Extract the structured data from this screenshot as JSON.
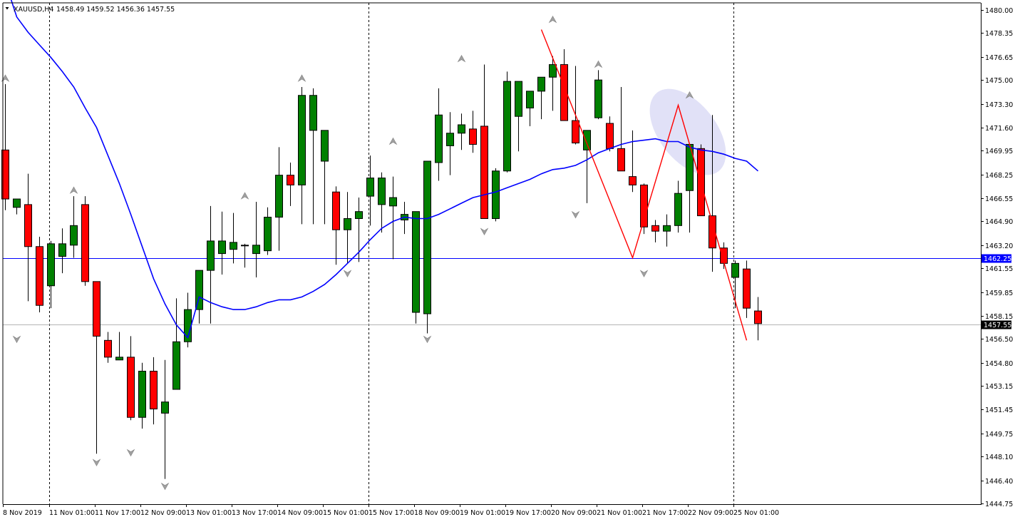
{
  "header": {
    "symbol": "XAUUSD,H4",
    "ohlc": "1458.49 1459.52 1456.36 1457.55"
  },
  "price_labels": {
    "horizontal_line": "1462.25",
    "current_price": "1457.55"
  },
  "colors": {
    "bull": "#008000",
    "bear": "#ff0000",
    "ma": "#0000ff",
    "zigzag": "#ff0000",
    "hline": "#0000ff",
    "highlight": "#c8c8f0",
    "grid_sep": "#000000"
  },
  "chart_data": {
    "type": "candlestick",
    "symbol": "XAUUSD",
    "timeframe": "H4",
    "ylim": [
      1444.75,
      1480.0
    ],
    "y_ticks": [
      "1480.00",
      "1478.35",
      "1476.65",
      "1475.00",
      "1473.30",
      "1471.60",
      "1469.95",
      "1468.25",
      "1466.55",
      "1464.90",
      "1463.20",
      "1461.55",
      "1459.85",
      "1458.15",
      "1456.50",
      "1454.80",
      "1453.15",
      "1451.45",
      "1449.75",
      "1448.10",
      "1446.40",
      "1444.75"
    ],
    "x_ticks": [
      "8 Nov 2019",
      "11 Nov 01:00",
      "11 Nov 17:00",
      "12 Nov 09:00",
      "13 Nov 01:00",
      "13 Nov 17:00",
      "14 Nov 09:00",
      "15 Nov 01:00",
      "15 Nov 17:00",
      "18 Nov 09:00",
      "19 Nov 01:00",
      "19 Nov 17:00",
      "20 Nov 09:00",
      "21 Nov 01:00",
      "21 Nov 17:00",
      "22 Nov 09:00",
      "25 Nov 01:00"
    ],
    "candles": [
      [
        1470.0,
        1474.7,
        1465.7,
        1466.5
      ],
      [
        1465.9,
        1466.5,
        1465.4,
        1466.5
      ],
      [
        1466.1,
        1468.3,
        1459.2,
        1463.1
      ],
      [
        1463.1,
        1463.8,
        1458.4,
        1458.9
      ],
      [
        1460.3,
        1463.5,
        1458.7,
        1463.3
      ],
      [
        1462.4,
        1464.4,
        1461.2,
        1463.3
      ],
      [
        1463.2,
        1466.7,
        1462.3,
        1464.6
      ],
      [
        1466.1,
        1466.7,
        1460.3,
        1460.6
      ],
      [
        1460.6,
        1460.6,
        1448.3,
        1456.7
      ],
      [
        1456.4,
        1457.0,
        1454.8,
        1455.2
      ],
      [
        1455.0,
        1457.0,
        1455.0,
        1455.2
      ],
      [
        1455.2,
        1456.7,
        1450.7,
        1450.9
      ],
      [
        1450.9,
        1454.8,
        1450.1,
        1454.2
      ],
      [
        1454.2,
        1455.2,
        1450.4,
        1451.5
      ],
      [
        1451.2,
        1455.0,
        1446.5,
        1452.0
      ],
      [
        1452.9,
        1459.4,
        1452.9,
        1456.3
      ],
      [
        1456.3,
        1459.8,
        1455.9,
        1458.6
      ],
      [
        1458.6,
        1461.4,
        1457.6,
        1461.4
      ],
      [
        1461.4,
        1466.0,
        1457.6,
        1463.5
      ],
      [
        1462.6,
        1465.6,
        1461.1,
        1463.5
      ],
      [
        1462.9,
        1465.5,
        1461.9,
        1463.4
      ],
      [
        1463.2,
        1463.3,
        1461.6,
        1463.2
      ],
      [
        1462.6,
        1466.3,
        1460.9,
        1463.2
      ],
      [
        1462.8,
        1465.9,
        1462.5,
        1465.2
      ],
      [
        1465.2,
        1470.2,
        1462.8,
        1468.2
      ],
      [
        1468.2,
        1469.1,
        1466.0,
        1467.5
      ],
      [
        1467.5,
        1474.5,
        1464.7,
        1473.9
      ],
      [
        1471.4,
        1474.4,
        1464.7,
        1473.9
      ],
      [
        1469.2,
        1471.4,
        1464.7,
        1471.4
      ],
      [
        1467.0,
        1467.4,
        1461.8,
        1464.3
      ],
      [
        1464.3,
        1467.0,
        1461.9,
        1465.1
      ],
      [
        1465.1,
        1466.6,
        1462.0,
        1465.6
      ],
      [
        1466.7,
        1469.6,
        1464.6,
        1468.0
      ],
      [
        1466.1,
        1468.4,
        1464.1,
        1468.0
      ],
      [
        1466.0,
        1468.1,
        1462.2,
        1466.6
      ],
      [
        1465.0,
        1466.3,
        1464.0,
        1465.4
      ],
      [
        1458.4,
        1465.6,
        1457.6,
        1465.6
      ],
      [
        1458.3,
        1468.9,
        1456.9,
        1469.2
      ],
      [
        1469.1,
        1474.4,
        1467.8,
        1472.5
      ],
      [
        1470.3,
        1472.7,
        1468.2,
        1471.2
      ],
      [
        1471.2,
        1472.6,
        1470.0,
        1471.8
      ],
      [
        1471.5,
        1472.8,
        1469.8,
        1470.4
      ],
      [
        1471.7,
        1476.1,
        1468.8,
        1465.1
      ],
      [
        1465.1,
        1468.7,
        1464.9,
        1468.5
      ],
      [
        1468.5,
        1475.6,
        1468.4,
        1474.9
      ],
      [
        1472.4,
        1474.9,
        1469.9,
        1474.9
      ],
      [
        1473.0,
        1474.0,
        1471.7,
        1474.2
      ],
      [
        1474.2,
        1475.2,
        1472.2,
        1475.2
      ],
      [
        1475.2,
        1476.7,
        1472.8,
        1476.1
      ],
      [
        1476.1,
        1477.2,
        1473.1,
        1472.1
      ],
      [
        1472.1,
        1476.0,
        1470.4,
        1470.5
      ],
      [
        1470.0,
        1470.4,
        1466.2,
        1471.4
      ],
      [
        1472.3,
        1475.7,
        1472.2,
        1475.0
      ],
      [
        1471.9,
        1472.4,
        1469.9,
        1470.1
      ],
      [
        1470.1,
        1474.5,
        1468.6,
        1468.5
      ],
      [
        1468.1,
        1471.4,
        1467.0,
        1467.5
      ],
      [
        1467.5,
        1467.6,
        1464.0,
        1464.5
      ],
      [
        1464.6,
        1465.0,
        1463.4,
        1464.2
      ],
      [
        1464.2,
        1465.4,
        1463.1,
        1464.6
      ],
      [
        1464.6,
        1467.8,
        1464.1,
        1466.9
      ],
      [
        1467.1,
        1469.9,
        1464.1,
        1470.4
      ],
      [
        1470.1,
        1470.4,
        1465.6,
        1465.3
      ],
      [
        1465.3,
        1472.5,
        1461.3,
        1463.0
      ],
      [
        1463.0,
        1463.4,
        1461.5,
        1461.9
      ],
      [
        1460.9,
        1462.1,
        1458.7,
        1461.9
      ],
      [
        1461.5,
        1462.1,
        1458.0,
        1458.7
      ],
      [
        1458.5,
        1459.5,
        1456.4,
        1457.6
      ]
    ],
    "moving_average": {
      "type": "line",
      "values": [
        1482.0,
        1479.5,
        1478.4,
        1477.5,
        1476.6,
        1475.6,
        1474.5,
        1473.0,
        1471.6,
        1469.6,
        1467.6,
        1465.4,
        1463.1,
        1460.8,
        1459.0,
        1457.5,
        1456.6,
        1459.5,
        1459.1,
        1458.8,
        1458.6,
        1458.6,
        1458.8,
        1459.1,
        1459.3,
        1459.3,
        1459.5,
        1459.9,
        1460.4,
        1461.1,
        1461.9,
        1462.7,
        1463.6,
        1464.4,
        1464.9,
        1465.2,
        1465.1,
        1465.1,
        1465.4,
        1465.8,
        1466.2,
        1466.6,
        1466.8,
        1467.0,
        1467.3,
        1467.6,
        1467.9,
        1468.3,
        1468.6,
        1468.7,
        1468.9,
        1469.3,
        1469.8,
        1470.1,
        1470.4,
        1470.6,
        1470.7,
        1470.8,
        1470.6,
        1470.6,
        1470.2,
        1470.0,
        1469.9,
        1469.7,
        1469.4,
        1469.2,
        1468.5
      ]
    },
    "zigzag": [
      {
        "i": 47,
        "price": 1478.6
      },
      {
        "i": 55,
        "price": 1462.3
      },
      {
        "i": 59,
        "price": 1473.2
      },
      {
        "i": 65,
        "price": 1456.4
      }
    ],
    "horizontal_line": 1462.25,
    "current_price": 1457.55,
    "fractals_up": [
      {
        "i": 0,
        "price": 1474.7
      },
      {
        "i": 6,
        "price": 1466.7
      },
      {
        "i": 21,
        "price": 1466.3
      },
      {
        "i": 26,
        "price": 1474.7
      },
      {
        "i": 34,
        "price": 1470.2
      },
      {
        "i": 40,
        "price": 1476.1
      },
      {
        "i": 48,
        "price": 1478.9
      },
      {
        "i": 52,
        "price": 1475.7
      },
      {
        "i": 60,
        "price": 1473.5
      }
    ],
    "fractals_down": [
      {
        "i": 1,
        "price": 1456.9
      },
      {
        "i": 8,
        "price": 1448.1
      },
      {
        "i": 11,
        "price": 1448.8
      },
      {
        "i": 14,
        "price": 1446.4
      },
      {
        "i": 30,
        "price": 1461.6
      },
      {
        "i": 37,
        "price": 1456.9
      },
      {
        "i": 42,
        "price": 1464.6
      },
      {
        "i": 50,
        "price": 1465.8
      },
      {
        "i": 56,
        "price": 1461.6
      }
    ],
    "period_separators": [
      "11 Nov 01:00",
      "15 Nov 17:00",
      "25 Nov 01:00"
    ],
    "grid": false
  }
}
